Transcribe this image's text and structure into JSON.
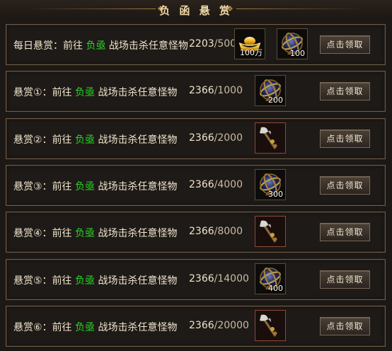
{
  "panel": {
    "title": "负 函 悬 赏"
  },
  "rows": [
    {
      "prefix": "每日悬赏：",
      "go": "前往",
      "place": "负亟",
      "suffix": "战场击杀任意怪物",
      "current": "2203",
      "target": "500",
      "rewards": [
        {
          "icon": "gold-ingot-icon",
          "count": "100万"
        },
        {
          "icon": "armillary-sphere-icon",
          "count": "100"
        }
      ],
      "button": "点击领取"
    },
    {
      "prefix": "悬赏①：",
      "go": "前往",
      "place": "负亟",
      "suffix": "战场击杀任意怪物",
      "current": "2366",
      "target": "1000",
      "rewards": [
        {
          "icon": "armillary-sphere-icon",
          "count": "200"
        }
      ],
      "button": "点击领取"
    },
    {
      "prefix": "悬赏②：",
      "go": "前往",
      "place": "负亟",
      "suffix": "战场击杀任意怪物",
      "current": "2366",
      "target": "2000",
      "rewards": [
        {
          "icon": "axe-weapon-icon",
          "count": ""
        }
      ],
      "button": "点击领取"
    },
    {
      "prefix": "悬赏③：",
      "go": "前往",
      "place": "负亟",
      "suffix": "战场击杀任意怪物",
      "current": "2366",
      "target": "4000",
      "rewards": [
        {
          "icon": "armillary-sphere-icon",
          "count": "300"
        }
      ],
      "button": "点击领取"
    },
    {
      "prefix": "悬赏④：",
      "go": "前往",
      "place": "负亟",
      "suffix": "战场击杀任意怪物",
      "current": "2366",
      "target": "8000",
      "rewards": [
        {
          "icon": "axe-weapon-icon",
          "count": ""
        }
      ],
      "button": "点击领取"
    },
    {
      "prefix": "悬赏⑤：",
      "go": "前往",
      "place": "负亟",
      "suffix": "战场击杀任意怪物",
      "current": "2366",
      "target": "14000",
      "rewards": [
        {
          "icon": "armillary-sphere-icon",
          "count": "400"
        }
      ],
      "button": "点击领取"
    },
    {
      "prefix": "悬赏⑥：",
      "go": "前往",
      "place": "负亟",
      "suffix": "战场击杀任意怪物",
      "current": "2366",
      "target": "20000",
      "rewards": [
        {
          "icon": "axe-weapon-icon",
          "count": ""
        }
      ],
      "button": "点击领取"
    }
  ],
  "colors": {
    "highlight": "#26d826",
    "border": "#6e5a44",
    "title": "#f0d9a8"
  }
}
